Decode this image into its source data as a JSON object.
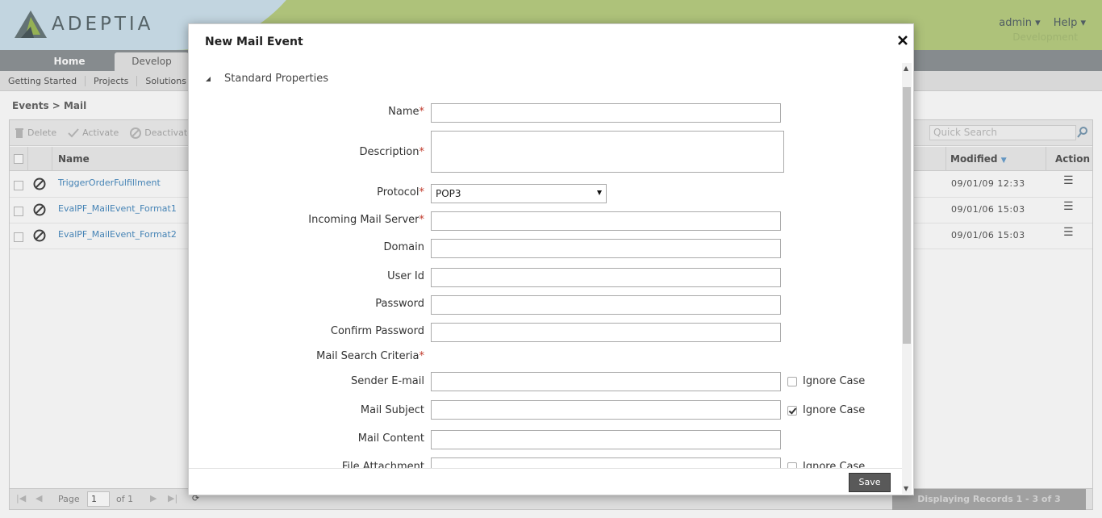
{
  "app": {
    "logo_text": "ADEPTIA",
    "user_menu": {
      "admin": "admin",
      "help": "Help"
    },
    "environment": "Development",
    "nav_tabs": [
      "Home",
      "Develop"
    ],
    "sub_nav": [
      "Getting Started",
      "Projects",
      "Solutions"
    ],
    "breadcrumb": "Events > Mail"
  },
  "grid": {
    "toolbar": {
      "delete": "Delete",
      "activate": "Activate",
      "deactivate": "Deactivate"
    },
    "quick_search_placeholder": "Quick Search",
    "columns": {
      "name": "Name",
      "modified": "Modified",
      "action": "Action"
    },
    "rows": [
      {
        "name": "TriggerOrderFulfillment",
        "modified": "09/01/09 12:33"
      },
      {
        "name": "EvalPF_MailEvent_Format1",
        "modified": "09/01/06 15:03"
      },
      {
        "name": "EvalPF_MailEvent_Format2",
        "modified": "09/01/06 15:03"
      }
    ],
    "pager": {
      "page_label": "Page",
      "page_value": "1",
      "of_label": "of 1",
      "display": "Displaying Records 1 - 3 of 3"
    }
  },
  "modal": {
    "title": "New Mail Event",
    "section": "Standard Properties",
    "fields": {
      "name": "Name",
      "description": "Description",
      "protocol": "Protocol",
      "protocol_value": "POP3",
      "incoming_server": "Incoming Mail Server",
      "domain": "Domain",
      "user_id": "User Id",
      "password": "Password",
      "confirm_password": "Confirm Password",
      "search_criteria": "Mail Search Criteria",
      "sender_email": "Sender E-mail",
      "mail_subject": "Mail Subject",
      "mail_content": "Mail Content",
      "file_attachment": "File Attachment"
    },
    "required_mark": "*",
    "ignore_case": "Ignore Case",
    "ignore_case_states": {
      "sender_email": false,
      "mail_subject": true,
      "file_attachment": false
    },
    "save": "Save"
  }
}
